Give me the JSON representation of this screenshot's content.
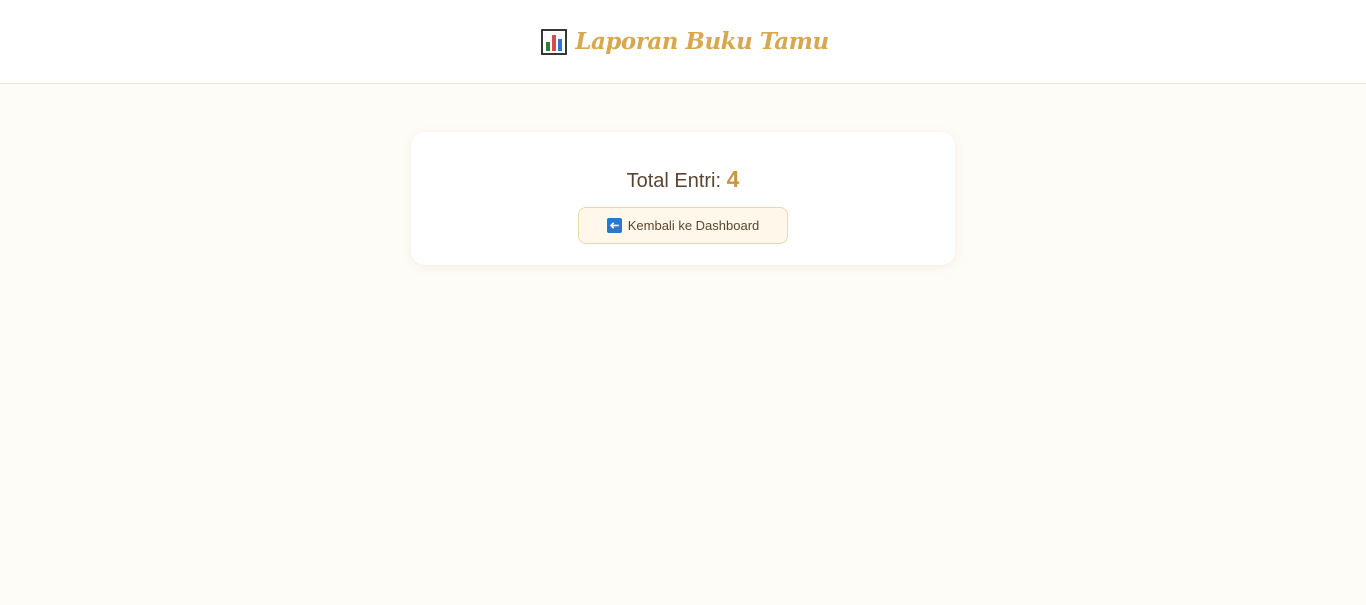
{
  "header": {
    "title": "Laporan Buku Tamu",
    "icon": "bar-chart-icon"
  },
  "summary": {
    "label": "Total Entri:",
    "value": "4"
  },
  "actions": {
    "back_label": "Kembali ke Dashboard",
    "back_icon": "left-arrow-icon"
  },
  "colors": {
    "accent": "#d7a84f",
    "background": "#fefcf7",
    "text": "#5a4632"
  }
}
